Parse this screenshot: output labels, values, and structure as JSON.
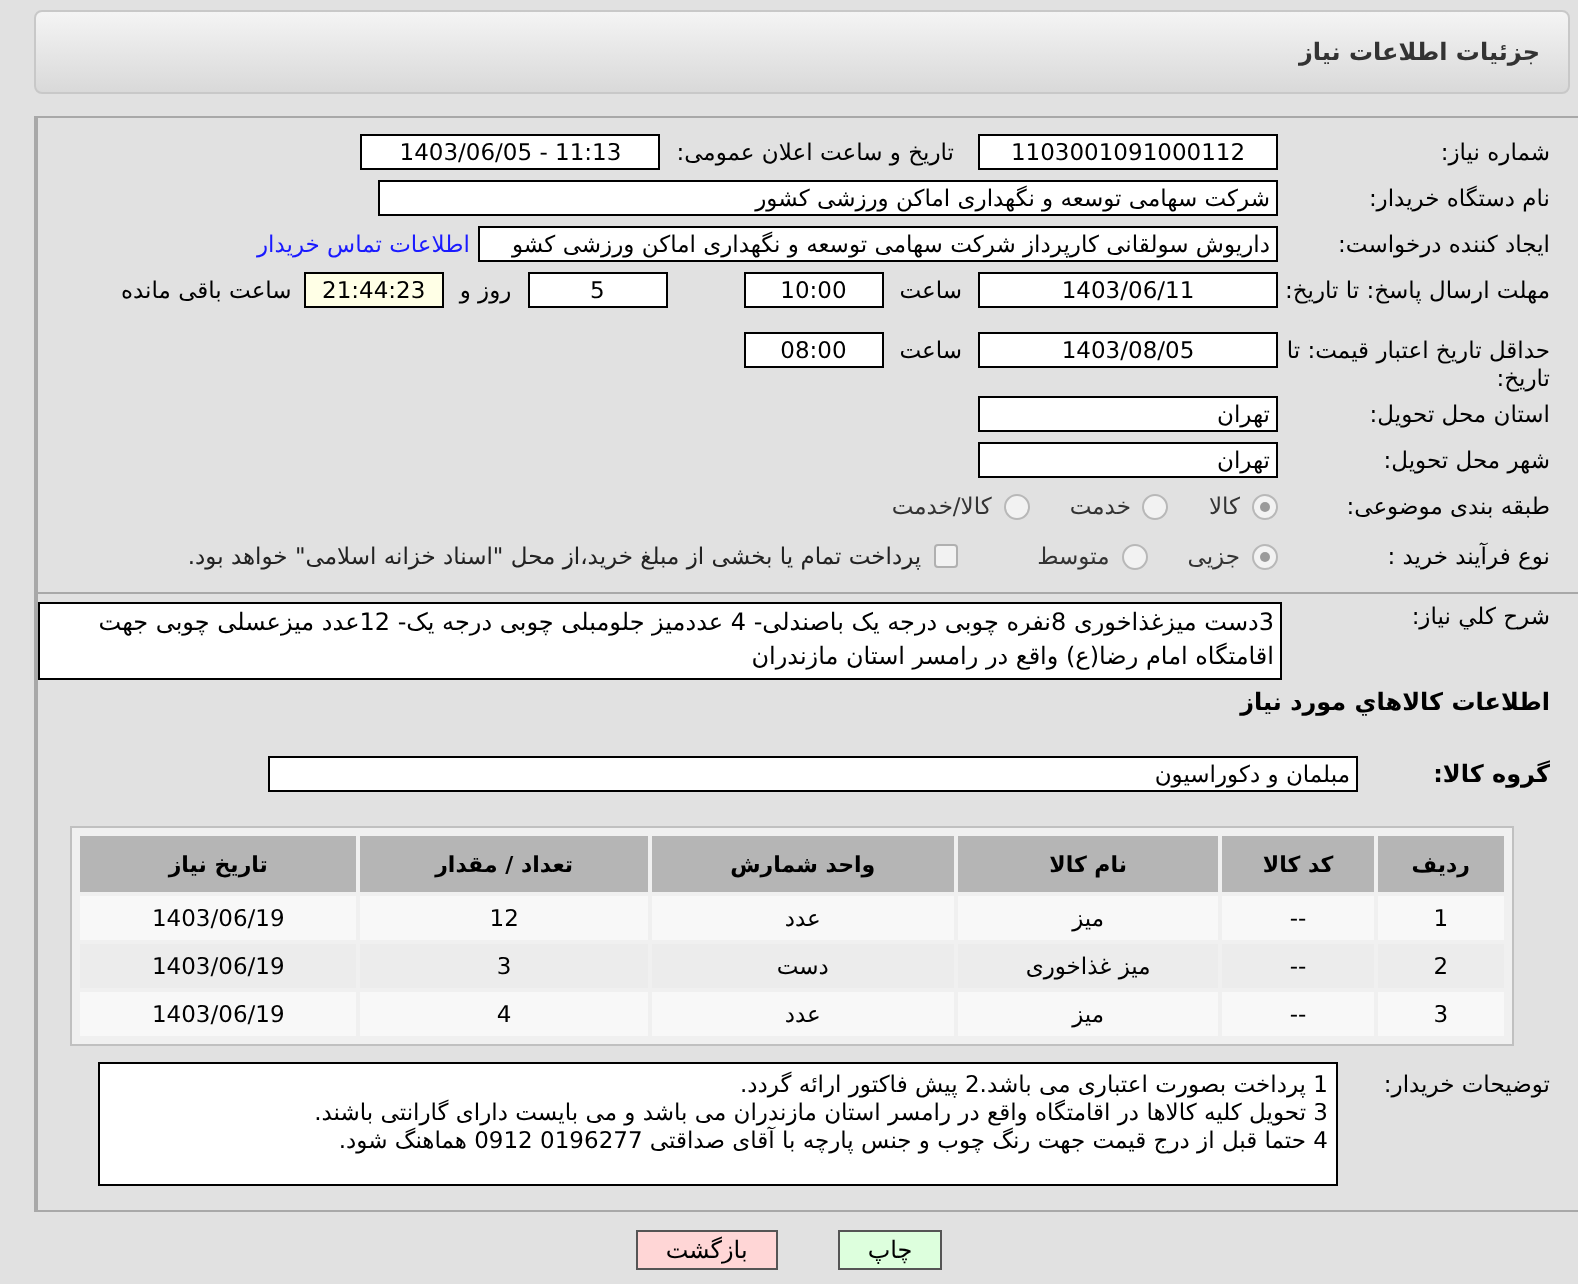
{
  "header": {
    "title": "جزئیات اطلاعات نیاز"
  },
  "fields": {
    "need_number": {
      "label": "شماره نیاز:",
      "value": "1103001091000112"
    },
    "announce": {
      "label": "تاریخ و ساعت اعلان عمومی:",
      "value": "1403/06/05 - 11:13"
    },
    "buyer": {
      "label": "نام دستگاه خریدار:",
      "value": "شرکت سهامی توسعه و نگهداری اماکن ورزشی کشور"
    },
    "creator": {
      "label": "ایجاد کننده درخواست:",
      "value": "داریوش سولقانی کارپرداز شرکت سهامی توسعه و نگهداری اماکن ورزشی کشو",
      "link": "اطلاعات تماس خریدار"
    },
    "deadline": {
      "label": "مهلت ارسال پاسخ: تا تاریخ:",
      "date": "1403/06/11",
      "time_label": "ساعت",
      "time": "10:00",
      "days": "5",
      "days_label": "روز و",
      "remaining": "21:44:23",
      "remaining_label": "ساعت باقی مانده"
    },
    "validity": {
      "label": "حداقل تاریخ اعتبار قیمت: تا تاریخ:",
      "date": "1403/08/05",
      "time_label": "ساعت",
      "time": "08:00"
    },
    "province": {
      "label": "استان محل تحویل:",
      "value": "تهران"
    },
    "city": {
      "label": "شهر محل تحویل:",
      "value": "تهران"
    },
    "category": {
      "label": "طبقه بندی موضوعی:",
      "options": [
        {
          "label": "کالا",
          "selected": true
        },
        {
          "label": "خدمت",
          "selected": false
        },
        {
          "label": "کالا/خدمت",
          "selected": false
        }
      ]
    },
    "process": {
      "label": "نوع فرآیند خرید :",
      "options": [
        {
          "label": "جزیی",
          "selected": true
        },
        {
          "label": "متوسط",
          "selected": false
        }
      ],
      "treasury": {
        "checked": false,
        "label": "پرداخت تمام یا بخشی از مبلغ خرید،از محل \"اسناد خزانه اسلامی\" خواهد بود."
      }
    }
  },
  "description": {
    "label": "شرح کلي نياز:",
    "value": "3دست میزغذاخوری 8نفره چوبی درجه یک باصندلی- 4 عددمیز جلومبلی چوبی درجه یک- 12عدد میزعسلی چوبی جهت اقامتگاه امام رضا(ع) واقع در رامسر استان مازندران"
  },
  "goods_heading": "اطلاعات كالاهاي مورد نياز",
  "goods_group": {
    "label": "گروه کالا:",
    "value": "مبلمان و دکوراسیون"
  },
  "table": {
    "columns": [
      "ردیف",
      "کد کالا",
      "نام کالا",
      "واحد شمارش",
      "تعداد / مقدار",
      "تاریخ نیاز"
    ],
    "rows": [
      [
        "1",
        "--",
        "میز",
        "عدد",
        "12",
        "1403/06/19"
      ],
      [
        "2",
        "--",
        "میز غذاخوری",
        "دست",
        "3",
        "1403/06/19"
      ],
      [
        "3",
        "--",
        "میز",
        "عدد",
        "4",
        "1403/06/19"
      ]
    ]
  },
  "notes": {
    "label": "توضیحات خریدار:",
    "lines": [
      "1 پرداخت بصورت اعتباری می باشد.2 پیش فاکتور ارائه گردد.",
      "3 تحویل کلیه کالاها در اقامتگاه واقع در رامسر استان مازندران می باشد و می بایست دارای گارانتی باشند.",
      "4 حتما قبل از درج قیمت جهت رنگ چوب و جنس پارچه با آقای صداقتی 0196277  0912 هماهنگ شود."
    ]
  },
  "buttons": [
    {
      "kind": "print",
      "label": "چاپ"
    },
    {
      "kind": "back",
      "label": "بازگشت"
    }
  ]
}
